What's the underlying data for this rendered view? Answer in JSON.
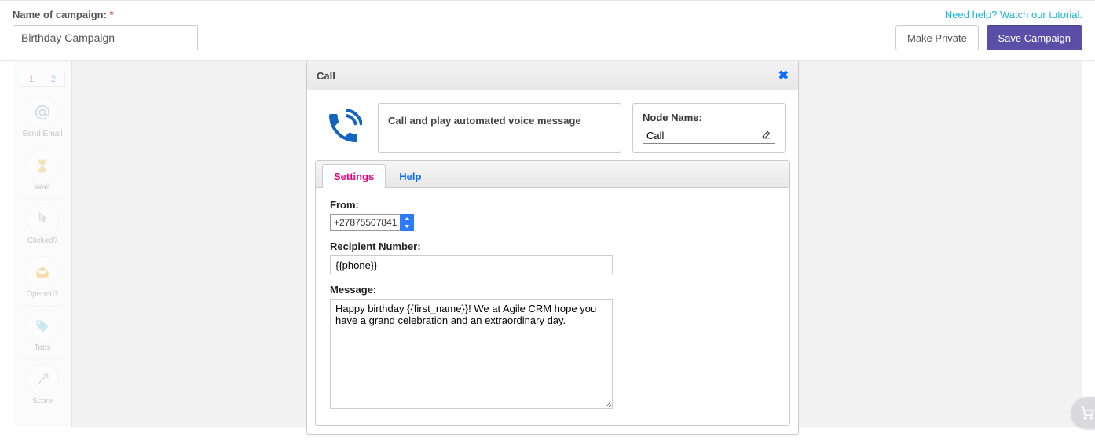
{
  "header": {
    "campaign_label": "Name of campaign:",
    "campaign_value": "Birthday Campaign",
    "tutorial_link": "Need help? Watch our tutorial.",
    "make_private": "Make Private",
    "save_campaign": "Save Campaign"
  },
  "palette": {
    "tab1": "1",
    "tab2": "2",
    "items": [
      {
        "label": "Send Email"
      },
      {
        "label": "Wait"
      },
      {
        "label": "Clicked?"
      },
      {
        "label": "Opened?"
      },
      {
        "label": "Tags"
      },
      {
        "label": "Score"
      }
    ]
  },
  "dialog": {
    "title": "Call",
    "description": "Call and play automated voice message",
    "nodename_label": "Node Name:",
    "nodename_value": "Call",
    "tabs": {
      "settings": "Settings",
      "help": "Help"
    },
    "from_label": "From:",
    "from_value": "+27875507841",
    "recipient_label": "Recipient Number:",
    "recipient_value": "{{phone}}",
    "message_label": "Message:",
    "message_value": "Happy birthday {{first_name}}! We at Agile CRM hope you have a grand celebration and an extraordinary day."
  }
}
